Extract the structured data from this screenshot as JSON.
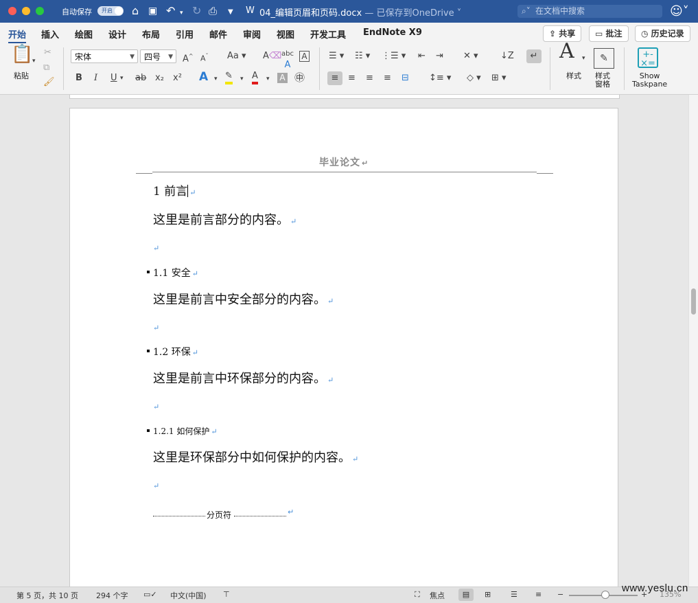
{
  "titlebar": {
    "autosave_label": "自动保存",
    "autosave_state": "开启",
    "doc_name": "04_编辑页眉和页码.docx",
    "saved_status": " — 已保存到OneDrive ˅",
    "search_placeholder": "在文档中搜索"
  },
  "tabs": [
    "开始",
    "插入",
    "绘图",
    "设计",
    "布局",
    "引用",
    "邮件",
    "审阅",
    "视图",
    "开发工具",
    "EndNote X9"
  ],
  "top_buttons": {
    "share": "共享",
    "comments": "批注",
    "history": "历史记录"
  },
  "ribbon": {
    "paste_label": "粘贴",
    "font_name": "宋体",
    "font_size": "四号",
    "styles_label": "样式",
    "styles_pane_label_1": "样式",
    "styles_pane_label_2": "窗格",
    "taskpane_label_1": "Show",
    "taskpane_label_2": "Taskpane",
    "bold": "B",
    "italic": "I",
    "underline": "U",
    "strike": "ab",
    "subscript": "x₂",
    "superscript": "x²"
  },
  "document": {
    "header_text": "毕业论文",
    "paragraph_mark": "↵",
    "heading1": "1  前言",
    "p1": "这里是前言部分的内容。",
    "h2_1": "1.1  安全",
    "p2": "这里是前言中安全部分的内容。",
    "h2_2": "1.2  环保",
    "p3": "这里是前言中环保部分的内容。",
    "h3_1": "1.2.1  如何保护",
    "p4": "这里是环保部分中如何保护的内容。",
    "page_break": "分页符"
  },
  "status": {
    "page_info": "第 5 页，共 10 页",
    "word_count": "294 个字",
    "language": "中文(中国)",
    "focus": "焦点",
    "zoom_percent": "135%"
  },
  "watermark": "www.yeslu.cn",
  "colors": {
    "brand": "#2b579a",
    "paragraph_mark": "#4a90d9"
  }
}
